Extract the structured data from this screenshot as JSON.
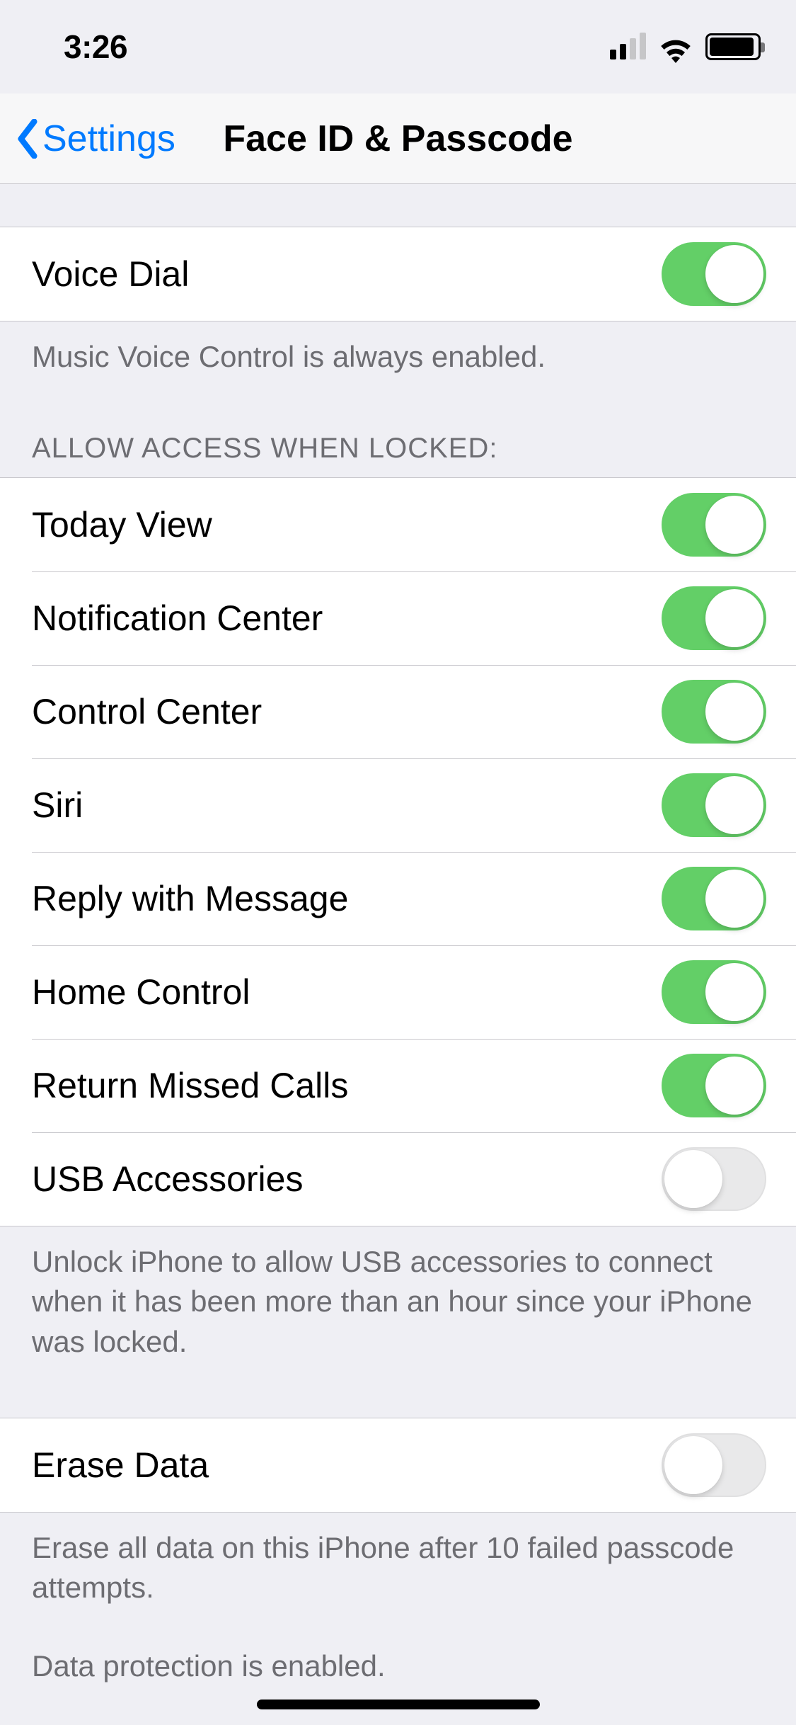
{
  "status": {
    "time": "3:26"
  },
  "nav": {
    "back_label": "Settings",
    "title": "Face ID & Passcode"
  },
  "groups": {
    "voice_dial": {
      "items": [
        {
          "label": "Voice Dial",
          "on": true
        }
      ],
      "footer": "Music Voice Control is always enabled."
    },
    "allow_access": {
      "header": "ALLOW ACCESS WHEN LOCKED:",
      "items": [
        {
          "label": "Today View",
          "on": true
        },
        {
          "label": "Notification Center",
          "on": true
        },
        {
          "label": "Control Center",
          "on": true
        },
        {
          "label": "Siri",
          "on": true
        },
        {
          "label": "Reply with Message",
          "on": true
        },
        {
          "label": "Home Control",
          "on": true
        },
        {
          "label": "Return Missed Calls",
          "on": true
        },
        {
          "label": "USB Accessories",
          "on": false
        }
      ],
      "footer": "Unlock iPhone to allow USB accessories to connect when it has been more than an hour since your iPhone was locked."
    },
    "erase_data": {
      "items": [
        {
          "label": "Erase Data",
          "on": false
        }
      ],
      "footer1": "Erase all data on this iPhone after 10 failed passcode attempts.",
      "footer2": "Data protection is enabled."
    }
  }
}
